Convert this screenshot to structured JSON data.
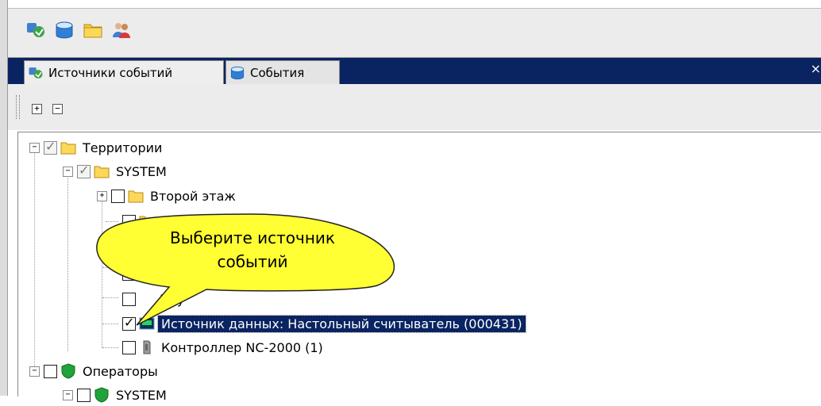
{
  "toolbar": {
    "icons": [
      "event-sources-icon",
      "database-icon",
      "folder-icon",
      "users-icon"
    ]
  },
  "tabs": [
    {
      "label": "Источники событий",
      "icon": "event-sources-icon",
      "active": true
    },
    {
      "label": "События",
      "icon": "database-icon",
      "active": false
    }
  ],
  "tab_close": "×",
  "subbar": {
    "expand_all": "+",
    "collapse_all": "−"
  },
  "tree": {
    "territories": "Территории",
    "system": "SYSTEM",
    "second_floor": "Второй этаж",
    "partial_item": "Пау",
    "data_source": "Источник данных: Настольный считыватель (000431)",
    "controller": "Контроллер NC-2000 (1)",
    "operators": "Операторы",
    "operators_system": "SYSTEM"
  },
  "tooltip": {
    "line1": "Выберите источник",
    "line2": "событий"
  },
  "colors": {
    "tab_bar": "#0a2461",
    "selection": "#0a2461",
    "balloon": "#ffff33",
    "folder": "#f6c83c"
  }
}
